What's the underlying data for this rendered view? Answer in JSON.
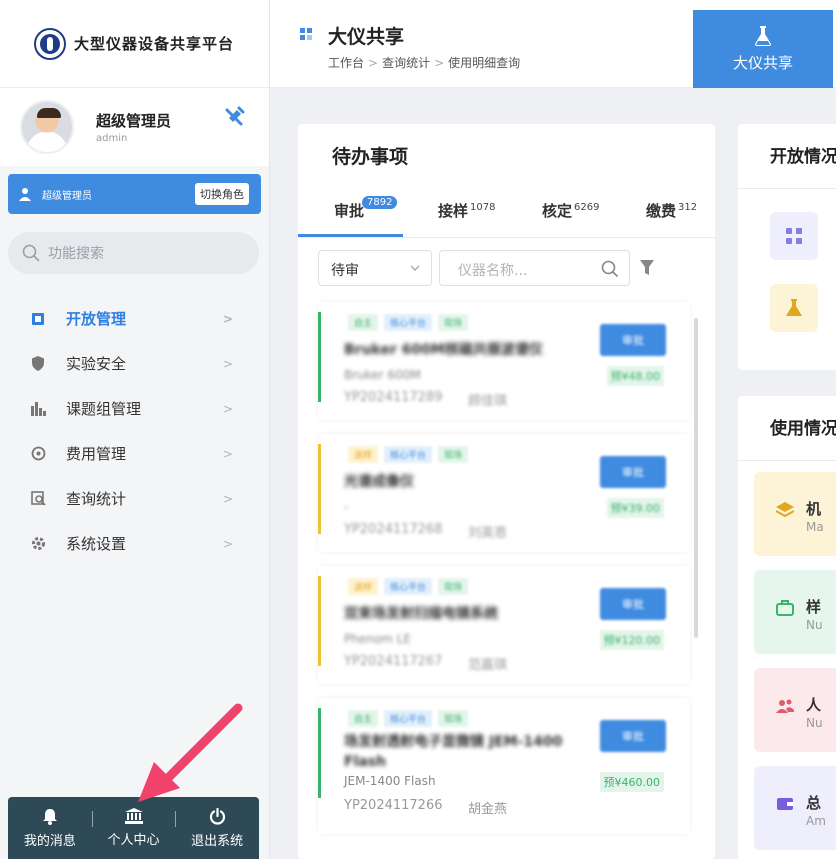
{
  "app": {
    "logo_text": "大型仪器设备共享平台"
  },
  "user": {
    "name": "超级管理员",
    "account": "admin",
    "role_label": "超级管理员",
    "switch_role": "切换角色"
  },
  "sidebar": {
    "search_placeholder": "功能搜索",
    "items": [
      {
        "label": "开放管理",
        "icon": "open-mgmt-icon",
        "active": true
      },
      {
        "label": "实验安全",
        "icon": "shield-icon"
      },
      {
        "label": "课题组管理",
        "icon": "group-icon"
      },
      {
        "label": "费用管理",
        "icon": "fee-icon"
      },
      {
        "label": "查询统计",
        "icon": "query-icon"
      },
      {
        "label": "系统设置",
        "icon": "gear-icon"
      }
    ],
    "bottom": [
      {
        "label": "我的消息",
        "icon": "bell-icon"
      },
      {
        "label": "个人中心",
        "icon": "bank-icon"
      },
      {
        "label": "退出系统",
        "icon": "power-icon"
      }
    ]
  },
  "header": {
    "title": "大仪共享",
    "breadcrumb": [
      "工作台",
      "查询统计",
      "使用明细查询"
    ],
    "top_tab": "大仪共享"
  },
  "todo": {
    "title": "待办事项",
    "tabs": [
      {
        "label": "审批",
        "count": "7892"
      },
      {
        "label": "接样",
        "count": "1078"
      },
      {
        "label": "核定",
        "count": "6269"
      },
      {
        "label": "缴费",
        "count": "312"
      }
    ],
    "status_select": "待审",
    "name_placeholder": "仪器名称...",
    "records": [
      {
        "tags": [
          "自主",
          "核心平台",
          "现场"
        ],
        "name": "Bruker 600M核磁共振波谱仪",
        "model": "Bruker 600M",
        "code": "YP2024117289",
        "user": "顾佳琪",
        "button": "审批",
        "amount": "预¥48.00",
        "stripe": "#3bb36b"
      },
      {
        "tags": [
          "送样",
          "核心平台",
          "现场"
        ],
        "name": "光谱成像仪",
        "model": "-",
        "code": "YP2024117268",
        "user": "刘英恩",
        "button": "审批",
        "amount": "预¥39.00",
        "stripe": "#f0c233"
      },
      {
        "tags": [
          "送样",
          "核心平台",
          "现场"
        ],
        "name": "双束场发射扫描电镜系统",
        "model": "Phenom LE",
        "code": "YP2024117267",
        "user": "范嘉琪",
        "button": "审批",
        "amount": "预¥120.00",
        "stripe": "#f0c233"
      },
      {
        "tags": [
          "自主",
          "核心平台",
          "现场"
        ],
        "name": "场发射透射电子显微镜 JEM-1400 Flash",
        "model": "JEM-1400 Flash",
        "code": "YP2024117266",
        "user": "胡金燕",
        "button": "审批",
        "amount": "预¥460.00",
        "stripe": "#3bb36b"
      }
    ]
  },
  "open_panel": {
    "title": "开放情况"
  },
  "use_panel": {
    "title": "使用情况",
    "stats": [
      {
        "title": "机",
        "sub": "Ma",
        "bg": "#fdf3d7",
        "icon": "layers-icon"
      },
      {
        "title": "样",
        "sub": "Nu",
        "bg": "#e6f6ec",
        "icon": "bag-icon"
      },
      {
        "title": "人",
        "sub": "Nu",
        "bg": "#fbe9ec",
        "icon": "people-icon"
      },
      {
        "title": "总",
        "sub": "Am",
        "bg": "#efeefc",
        "icon": "wallet-icon"
      }
    ]
  },
  "colors": {
    "primary": "#3f8be0",
    "sidebar_bottom": "#2e4a57",
    "arrow": "#f0426a"
  }
}
